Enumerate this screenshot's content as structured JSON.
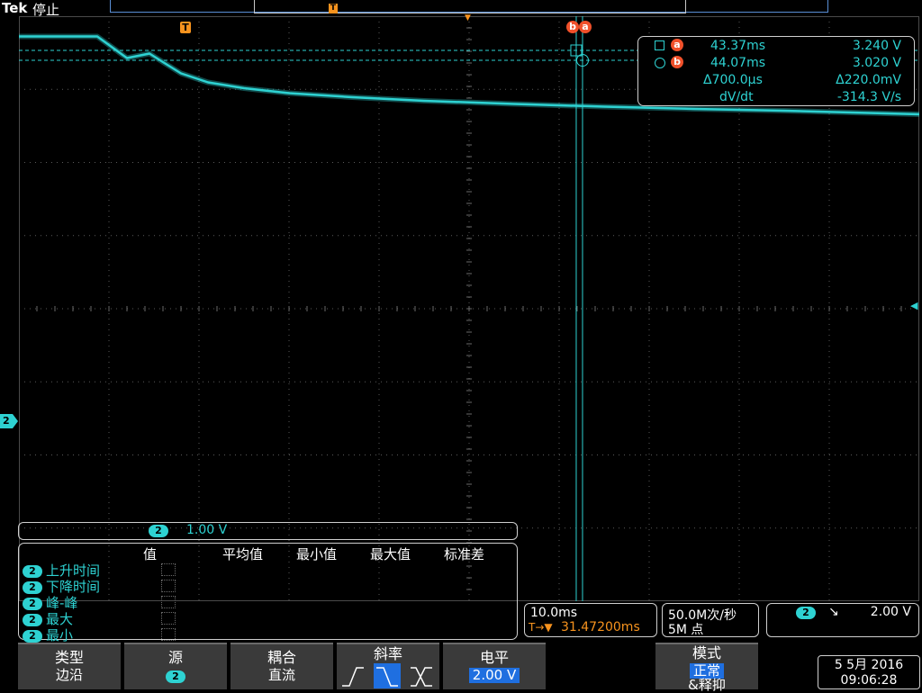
{
  "header": {
    "brand": "Tek",
    "run_state": "停止"
  },
  "markers": {
    "trigger_position": "T",
    "cursor_b": "b",
    "cursor_a": "a",
    "ch2_ground": "2",
    "trigger_level": "◀"
  },
  "cursor_readout": {
    "a_label": "a",
    "a_time": "43.37ms",
    "a_volt": "3.240 V",
    "b_label": "b",
    "b_time": "44.07ms",
    "b_volt": "3.020 V",
    "delta_time": "Δ700.0µs",
    "delta_volt": "Δ220.0mV",
    "slope_label": "dV/dt",
    "slope_value": "-314.3 V/s"
  },
  "channel_scale": {
    "channel": "2",
    "volts_per_div": "1.00 V"
  },
  "measurements": {
    "headers": [
      "值",
      "平均值",
      "最小值",
      "最大值",
      "标准差"
    ],
    "rows": [
      {
        "channel": "2",
        "name": "上升时间"
      },
      {
        "channel": "2",
        "name": "下降时间"
      },
      {
        "channel": "2",
        "name": "峰-峰"
      },
      {
        "channel": "2",
        "name": "最大"
      },
      {
        "channel": "2",
        "name": "最小"
      }
    ]
  },
  "timebase": {
    "scale": "10.0ms",
    "trigger_prefix": "T→▼",
    "delay": "31.47200ms"
  },
  "acquisition": {
    "sample_rate": "50.0M次/秒",
    "record_length": "5M 点"
  },
  "trigger": {
    "channel": "2",
    "slope_symbol": "↘",
    "level": "2.00 V"
  },
  "softkeys": [
    {
      "label": "类型",
      "value": "边沿"
    },
    {
      "label": "源",
      "value": "2"
    },
    {
      "label": "耦合",
      "value": "直流"
    },
    {
      "label": "斜率",
      "value": ""
    },
    {
      "label": "电平",
      "value": "2.00 V"
    },
    {
      "label": "模式",
      "value": "正常",
      "extra": "&释抑"
    }
  ],
  "slope_options": [
    "rising",
    "falling",
    "either"
  ],
  "datetime": {
    "date": "5 5月 2016",
    "time": "09:06:28"
  },
  "colors": {
    "ch2": "#2ed2d2",
    "cursor_marker": "#f0502a",
    "trigger": "#f7931e",
    "highlight": "#1f6fe0"
  },
  "chart_data": {
    "type": "line",
    "x": [
      0,
      8.7,
      12.0,
      14.5,
      16.0,
      18.0,
      21.0,
      25.0,
      30.0,
      37.0,
      45.0,
      55.0,
      65.0,
      75.0,
      85.0,
      100.0
    ],
    "series": [
      {
        "values": [
          3.55,
          3.55,
          3.07,
          3.17,
          2.98,
          2.73,
          2.53,
          2.4,
          2.29,
          2.2,
          2.12,
          2.05,
          1.99,
          1.94,
          1.9,
          1.82
        ]
      }
    ],
    "xlim": [
      0,
      100
    ],
    "ylim": [
      -9.0,
      4.0
    ],
    "grid": true
  }
}
